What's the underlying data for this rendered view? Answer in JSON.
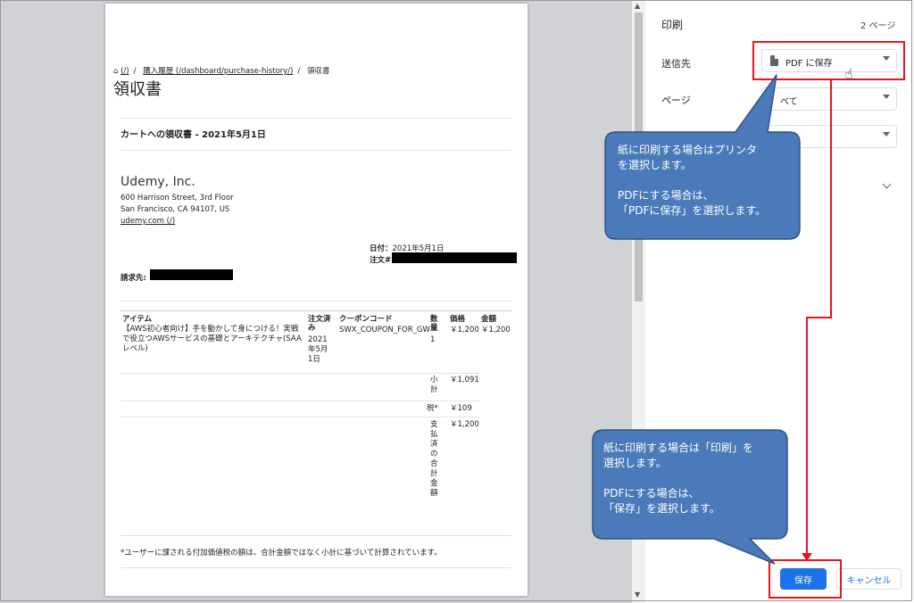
{
  "receipt": {
    "breadcrumb": {
      "home": "(/)",
      "history": "購入履歴 (/dashboard/purchase-history/)",
      "current": "領収書"
    },
    "page_title": "領収書",
    "cart_title": "カートへの領収書 - 2021年5月1日",
    "company": "Udemy, Inc.",
    "address_line1": "600 Harrison Street, 3rd Floor",
    "address_line2": "San Francisco, CA 94107, US",
    "website": "udemy.com (/)",
    "date_label": "日付：",
    "date_value": "2021年5月1日",
    "order_label": "注文#:",
    "bill_label": "請求先:",
    "table": {
      "headers": {
        "item": "アイテム",
        "ordered": "注文済み",
        "coupon": "クーポンコード",
        "qty": "数量",
        "price": "価格",
        "amount": "金額"
      },
      "row": {
        "item": "【AWS初心者向け】手を動かして身につける！実戦で役立つAWSサービスの基礎とアーキテクチャ(SAAレベル)",
        "ordered": "2021年5月1日",
        "coupon": "SWX_COUPON_FOR_GW",
        "qty": "1",
        "price": "￥1,200",
        "amount": "￥1,200"
      },
      "subtotal_label": "小計",
      "subtotal_value": "￥1,091",
      "tax_label": "税*",
      "tax_value": "￥109",
      "total_label": "支払済の合計金額",
      "total_value": "￥1,200"
    },
    "footnote": "*ユーザーに課される付加価値税の額は、合計金額ではなく小計に基づいて計算されています。"
  },
  "settings": {
    "title": "印刷",
    "page_count": "2 ページ",
    "destination_label": "送信先",
    "destination_value": "PDF に保存",
    "pages_label": "ページ",
    "pages_value": "べて",
    "save_label": "保存",
    "cancel_label": "キャンセル"
  },
  "callouts": {
    "top": {
      "line1": "紙に印刷する場合はプリンタ",
      "line2": "を選択します。",
      "line3": "PDFにする場合は、",
      "line4": "「PDFに保存」を選択します。"
    },
    "bottom": {
      "line1": "紙に印刷する場合は「印刷」を",
      "line2": "選択します。",
      "line3": "PDFにする場合は、",
      "line4": "「保存」を選択します。"
    }
  },
  "colors": {
    "callout": "#4a7ab9",
    "highlight": "#e8141e",
    "primary": "#1a73e8"
  }
}
